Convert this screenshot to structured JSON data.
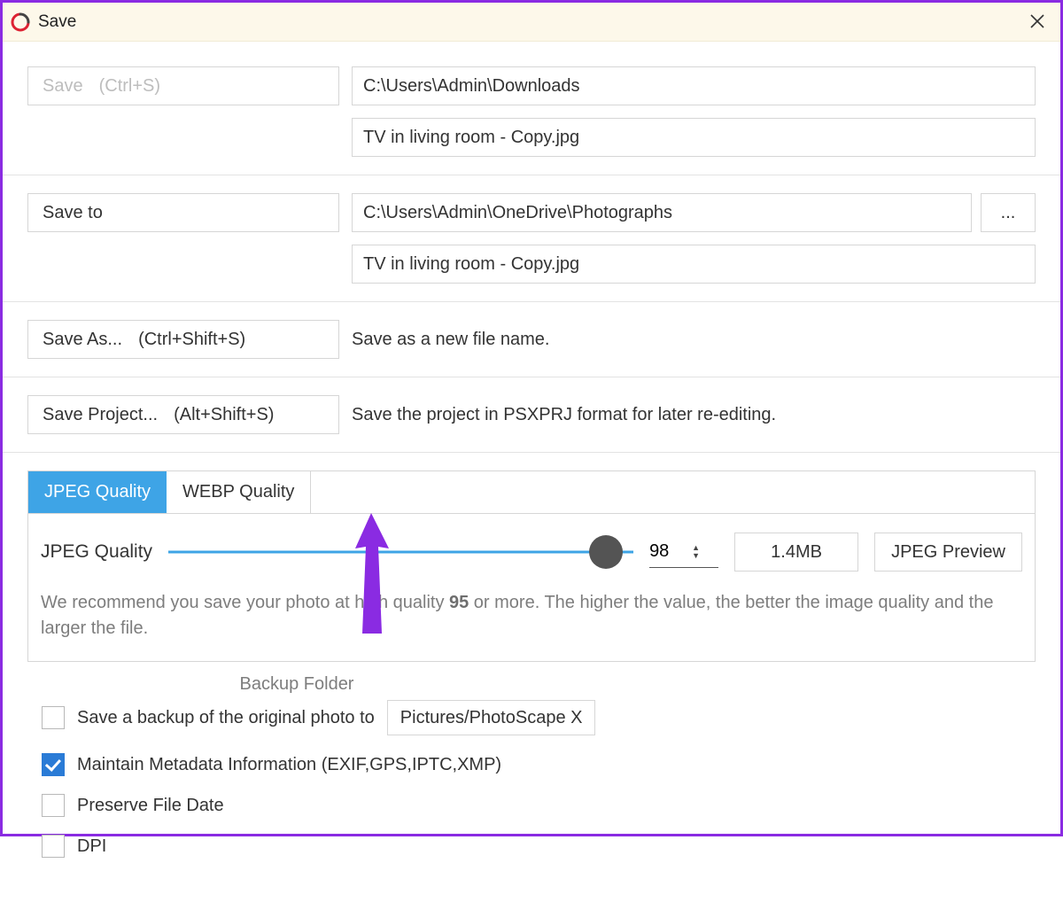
{
  "window": {
    "title": "Save"
  },
  "save": {
    "label": "Save",
    "shortcut": "(Ctrl+S)",
    "path": "C:\\Users\\Admin\\Downloads",
    "filename": "TV in living room - Copy.jpg"
  },
  "saveTo": {
    "label": "Save to",
    "path": "C:\\Users\\Admin\\OneDrive\\Photographs",
    "filename": "TV in living room - Copy.jpg",
    "browse": "..."
  },
  "saveAs": {
    "label": "Save As...",
    "shortcut": "(Ctrl+Shift+S)",
    "desc": "Save as a new file name."
  },
  "saveProject": {
    "label": "Save Project...",
    "shortcut": "(Alt+Shift+S)",
    "desc": "Save the project in PSXPRJ format for later re-editing."
  },
  "quality": {
    "tabs": {
      "jpeg": "JPEG Quality",
      "webp": "WEBP Quality"
    },
    "label": "JPEG Quality",
    "value": "98",
    "size": "1.4MB",
    "preview": "JPEG Preview",
    "hint_pre": "We recommend you save your photo at high quality ",
    "hint_bold": "95",
    "hint_post": " or more. The higher the value, the better the image quality and the larger the file."
  },
  "options": {
    "backup_header": "Backup Folder",
    "backup_label": "Save a backup of the original photo to",
    "backup_folder": "Pictures/PhotoScape X",
    "metadata": "Maintain Metadata Information (EXIF,GPS,IPTC,XMP)",
    "preserve_date": "Preserve File Date",
    "dpi": "DPI"
  }
}
